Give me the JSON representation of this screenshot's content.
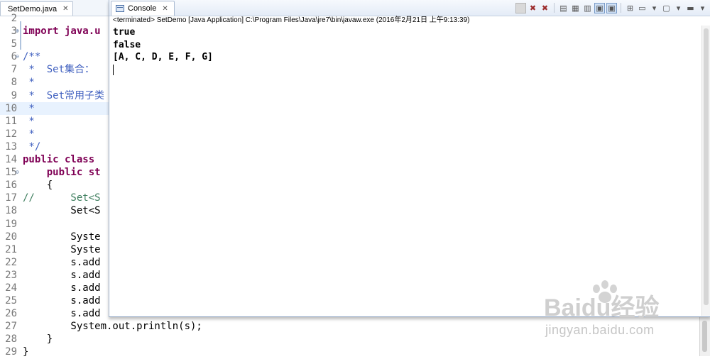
{
  "editor": {
    "tab_label": "SetDemo.java",
    "lines": [
      {
        "num": "2",
        "text": "",
        "style": "plain",
        "fold": "",
        "highlight": false
      },
      {
        "num": "3",
        "text": "import java.u",
        "style": "kw",
        "fold": "⊕",
        "highlight": false
      },
      {
        "num": "5",
        "text": "",
        "style": "plain",
        "fold": "",
        "highlight": false
      },
      {
        "num": "6",
        "text": "/**",
        "style": "comment",
        "fold": "⊖",
        "highlight": false
      },
      {
        "num": "7",
        "text": " *  Set集合：",
        "style": "comment",
        "fold": "",
        "highlight": false
      },
      {
        "num": "8",
        "text": " *          ",
        "style": "comment",
        "fold": "",
        "highlight": false
      },
      {
        "num": "9",
        "text": " *  Set常用子类",
        "style": "comment",
        "fold": "",
        "highlight": false
      },
      {
        "num": "10",
        "text": " *          ",
        "style": "comment",
        "fold": "",
        "highlight": true
      },
      {
        "num": "11",
        "text": " *          ",
        "style": "comment",
        "fold": "",
        "highlight": false
      },
      {
        "num": "12",
        "text": " *",
        "style": "comment",
        "fold": "",
        "highlight": false
      },
      {
        "num": "13",
        "text": " */",
        "style": "comment",
        "fold": "",
        "highlight": false
      },
      {
        "num": "14",
        "text": "public class ",
        "style": "kw",
        "fold": "",
        "highlight": false
      },
      {
        "num": "15",
        "text": "    public st",
        "style": "kw",
        "fold": "⊖",
        "highlight": false
      },
      {
        "num": "16",
        "text": "    {",
        "style": "plain",
        "fold": "",
        "highlight": false
      },
      {
        "num": "17",
        "text": "//      Set<S",
        "style": "green",
        "fold": "",
        "highlight": false
      },
      {
        "num": "18",
        "text": "        Set<S",
        "style": "plain",
        "fold": "",
        "highlight": false
      },
      {
        "num": "19",
        "text": "",
        "style": "plain",
        "fold": "",
        "highlight": false
      },
      {
        "num": "20",
        "text": "        Syste",
        "style": "plain",
        "fold": "",
        "highlight": false
      },
      {
        "num": "21",
        "text": "        Syste",
        "style": "plain",
        "fold": "",
        "highlight": false
      },
      {
        "num": "22",
        "text": "        s.add",
        "style": "plain",
        "fold": "",
        "highlight": false
      },
      {
        "num": "23",
        "text": "        s.add",
        "style": "plain",
        "fold": "",
        "highlight": false
      },
      {
        "num": "24",
        "text": "        s.add",
        "style": "plain",
        "fold": "",
        "highlight": false
      },
      {
        "num": "25",
        "text": "        s.add",
        "style": "plain",
        "fold": "",
        "highlight": false
      },
      {
        "num": "26",
        "text": "        s.add",
        "style": "plain",
        "fold": "",
        "highlight": false
      },
      {
        "num": "27",
        "text": "        System.out.println(s);",
        "style": "plain",
        "fold": "",
        "highlight": false
      },
      {
        "num": "28",
        "text": "    }",
        "style": "plain",
        "fold": "",
        "highlight": false
      },
      {
        "num": "29",
        "text": "}",
        "style": "plain",
        "fold": "",
        "highlight": false
      }
    ]
  },
  "console": {
    "tab_label": "Console",
    "description": "<terminated> SetDemo [Java Application] C:\\Program Files\\Java\\jre7\\bin\\javaw.exe (2016年2月21日 上午9:13:39)",
    "output": [
      "true",
      "false",
      "[A, C, D, E, F, G]"
    ],
    "toolbar_icons": [
      "terminate-icon",
      "remove-launch-icon",
      "remove-all-terminated-icon",
      "clear-console-icon",
      "scroll-lock-icon",
      "word-wrap-icon",
      "show-on-output-icon",
      "show-on-error-icon",
      "pin-console-icon",
      "display-console-icon",
      "open-console-icon",
      "view-menu-icon"
    ]
  },
  "watermark": {
    "brand": "Baidu经验",
    "url": "jingyan.baidu.com"
  }
}
